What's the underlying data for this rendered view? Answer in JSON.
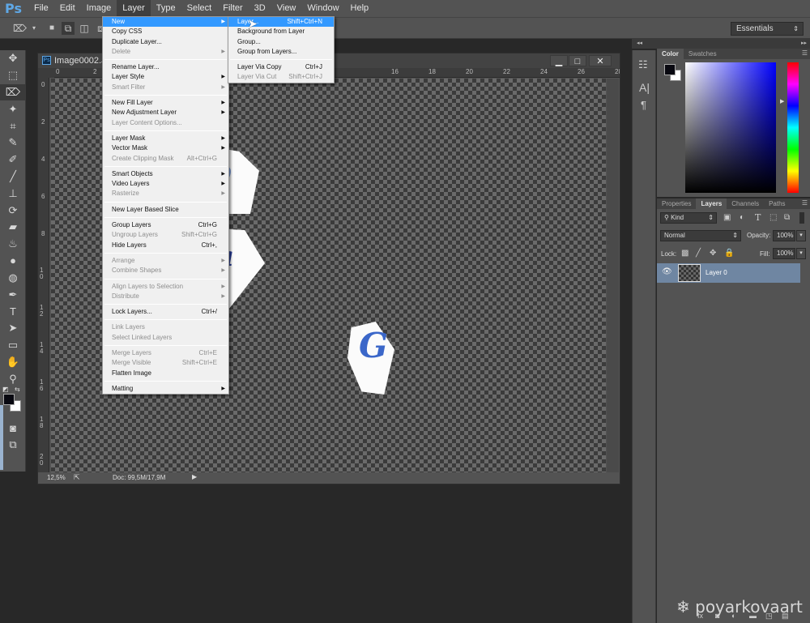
{
  "app": {
    "logo": "Ps"
  },
  "menubar": {
    "items": [
      "File",
      "Edit",
      "Image",
      "Layer",
      "Type",
      "Select",
      "Filter",
      "3D",
      "View",
      "Window",
      "Help"
    ],
    "active": "Layer"
  },
  "options_bar": {
    "workspace": "Essentials"
  },
  "document": {
    "title": "Image0002.JPG",
    "zoom": "12,5%",
    "doc_size": "Doc: 99,5M/17,9M",
    "h_ruler": [
      "0",
      "2",
      "16",
      "18",
      "20",
      "22",
      "24",
      "26",
      "28"
    ],
    "v_ruler": [
      "0",
      "2",
      "4",
      "6",
      "8",
      "10",
      "12",
      "14",
      "16",
      "18",
      "20"
    ],
    "window_buttons": {
      "minimize": "▁",
      "maximize": "□",
      "close": "✕"
    }
  },
  "layer_menu": {
    "items": [
      {
        "label": "New",
        "shortcut": "",
        "submenu": true,
        "disabled": false,
        "highlighted": true
      },
      {
        "label": "Copy CSS",
        "shortcut": "",
        "submenu": false,
        "disabled": false
      },
      {
        "label": "Duplicate Layer...",
        "shortcut": "",
        "submenu": false,
        "disabled": false
      },
      {
        "label": "Delete",
        "shortcut": "",
        "submenu": true,
        "disabled": true
      },
      {
        "sep": true
      },
      {
        "label": "Rename Layer...",
        "shortcut": "",
        "submenu": false,
        "disabled": false
      },
      {
        "label": "Layer Style",
        "shortcut": "",
        "submenu": true,
        "disabled": false
      },
      {
        "label": "Smart Filter",
        "shortcut": "",
        "submenu": true,
        "disabled": true
      },
      {
        "sep": true
      },
      {
        "label": "New Fill Layer",
        "shortcut": "",
        "submenu": true,
        "disabled": false
      },
      {
        "label": "New Adjustment Layer",
        "shortcut": "",
        "submenu": true,
        "disabled": false
      },
      {
        "label": "Layer Content Options...",
        "shortcut": "",
        "submenu": false,
        "disabled": true
      },
      {
        "sep": true
      },
      {
        "label": "Layer Mask",
        "shortcut": "",
        "submenu": true,
        "disabled": false
      },
      {
        "label": "Vector Mask",
        "shortcut": "",
        "submenu": true,
        "disabled": false
      },
      {
        "label": "Create Clipping Mask",
        "shortcut": "Alt+Ctrl+G",
        "submenu": false,
        "disabled": true
      },
      {
        "sep": true
      },
      {
        "label": "Smart Objects",
        "shortcut": "",
        "submenu": true,
        "disabled": false
      },
      {
        "label": "Video Layers",
        "shortcut": "",
        "submenu": true,
        "disabled": false
      },
      {
        "label": "Rasterize",
        "shortcut": "",
        "submenu": true,
        "disabled": true
      },
      {
        "sep": true
      },
      {
        "label": "New Layer Based Slice",
        "shortcut": "",
        "submenu": false,
        "disabled": false
      },
      {
        "sep": true
      },
      {
        "label": "Group Layers",
        "shortcut": "Ctrl+G",
        "submenu": false,
        "disabled": false
      },
      {
        "label": "Ungroup Layers",
        "shortcut": "Shift+Ctrl+G",
        "submenu": false,
        "disabled": true
      },
      {
        "label": "Hide Layers",
        "shortcut": "Ctrl+,",
        "submenu": false,
        "disabled": false
      },
      {
        "sep": true
      },
      {
        "label": "Arrange",
        "shortcut": "",
        "submenu": true,
        "disabled": true
      },
      {
        "label": "Combine Shapes",
        "shortcut": "",
        "submenu": true,
        "disabled": true
      },
      {
        "sep": true
      },
      {
        "label": "Align Layers to Selection",
        "shortcut": "",
        "submenu": true,
        "disabled": true
      },
      {
        "label": "Distribute",
        "shortcut": "",
        "submenu": true,
        "disabled": true
      },
      {
        "sep": true
      },
      {
        "label": "Lock Layers...",
        "shortcut": "Ctrl+/",
        "submenu": false,
        "disabled": false
      },
      {
        "sep": true
      },
      {
        "label": "Link Layers",
        "shortcut": "",
        "submenu": false,
        "disabled": true
      },
      {
        "label": "Select Linked Layers",
        "shortcut": "",
        "submenu": false,
        "disabled": true
      },
      {
        "sep": true
      },
      {
        "label": "Merge Layers",
        "shortcut": "Ctrl+E",
        "submenu": false,
        "disabled": true
      },
      {
        "label": "Merge Visible",
        "shortcut": "Shift+Ctrl+E",
        "submenu": false,
        "disabled": true
      },
      {
        "label": "Flatten Image",
        "shortcut": "",
        "submenu": false,
        "disabled": false
      },
      {
        "sep": true
      },
      {
        "label": "Matting",
        "shortcut": "",
        "submenu": true,
        "disabled": false
      }
    ]
  },
  "new_submenu": {
    "items": [
      {
        "label": "Layer...",
        "shortcut": "Shift+Ctrl+N",
        "disabled": false,
        "highlighted": true
      },
      {
        "label": "Background from Layer",
        "shortcut": "",
        "disabled": false
      },
      {
        "label": "Group...",
        "shortcut": "",
        "disabled": false
      },
      {
        "label": "Group from Layers...",
        "shortcut": "",
        "disabled": false
      },
      {
        "sep": true
      },
      {
        "label": "Layer Via Copy",
        "shortcut": "Ctrl+J",
        "disabled": false
      },
      {
        "label": "Layer Via Cut",
        "shortcut": "Shift+Ctrl+J",
        "disabled": true
      }
    ]
  },
  "color_panel": {
    "tabs": [
      "Color",
      "Swatches"
    ],
    "active": "Color",
    "foreground": "#080810",
    "background": "#ffffff",
    "hue": "#0000ff"
  },
  "layers_panel": {
    "tabs": [
      "Properties",
      "Layers",
      "Channels",
      "Paths"
    ],
    "active": "Layers",
    "filter": "Kind",
    "blend_mode": "Normal",
    "opacity_label": "Opacity:",
    "opacity": "100%",
    "lock_label": "Lock:",
    "fill_label": "Fill:",
    "fill": "100%",
    "layers": [
      {
        "name": "Layer 0",
        "visible": true,
        "selected": true
      }
    ]
  },
  "canvas_letters": [
    "b",
    "a",
    "G"
  ],
  "watermark": "poyarkovaart"
}
